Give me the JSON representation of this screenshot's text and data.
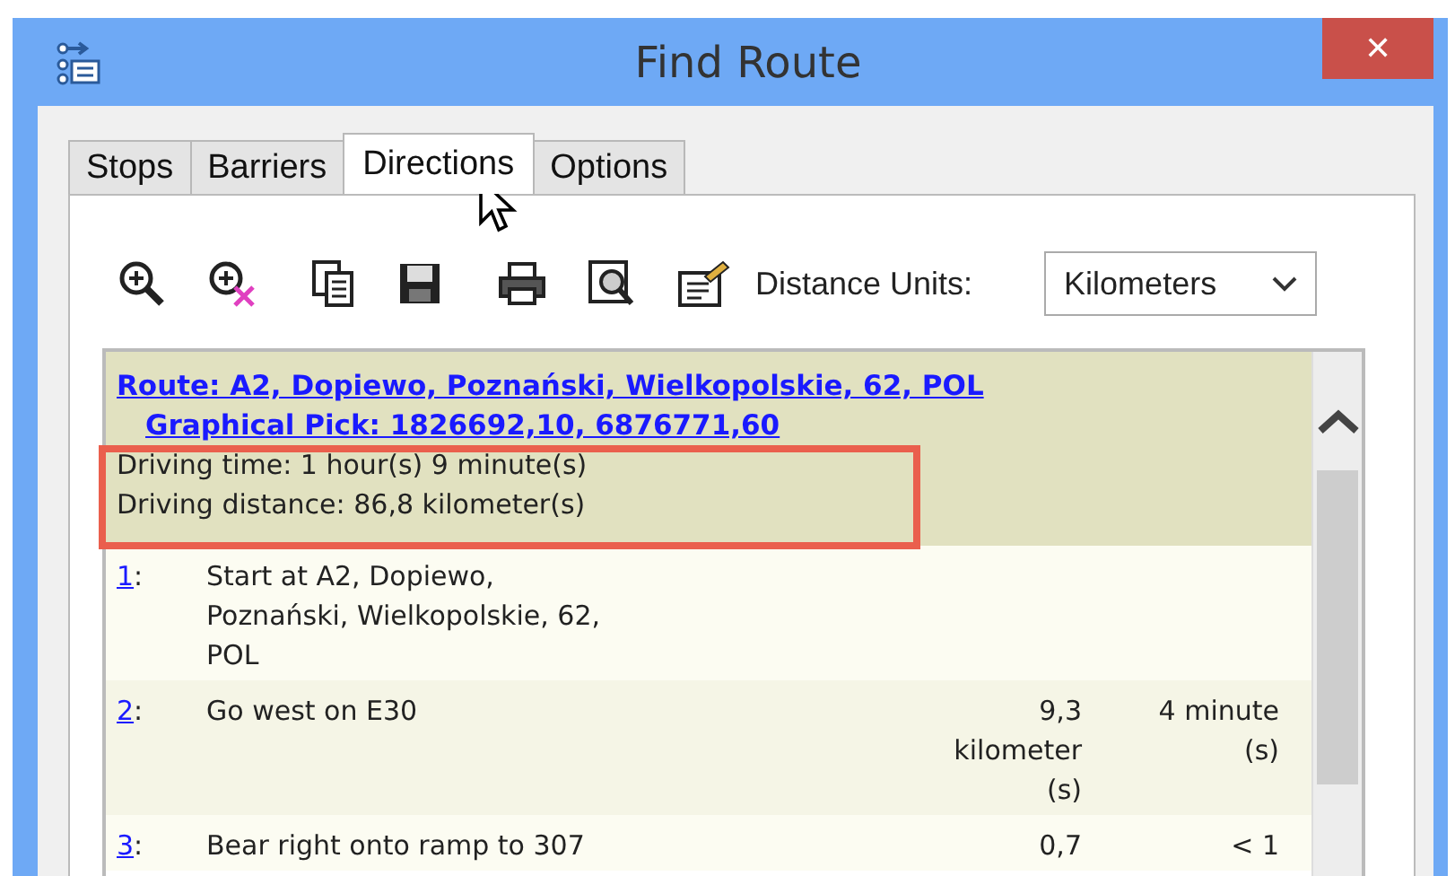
{
  "window": {
    "title": "Find Route",
    "close": "✕"
  },
  "tabs": [
    {
      "label": "Stops",
      "selected": false
    },
    {
      "label": "Barriers",
      "selected": false
    },
    {
      "label": "Directions",
      "selected": true
    },
    {
      "label": "Options",
      "selected": false
    }
  ],
  "toolbar": {
    "icons": [
      {
        "kind": "zoom-in"
      },
      {
        "kind": "zoom-out"
      },
      {
        "kind": "copy"
      },
      {
        "kind": "save"
      },
      {
        "kind": "print"
      },
      {
        "kind": "preview"
      },
      {
        "kind": "properties"
      }
    ],
    "units_label": "Distance Units:",
    "units_value": "Kilometers"
  },
  "route": {
    "link_lines": [
      "Route: A2, Dopiewo, Poznański, Wielkopolskie, 62, POL",
      "Graphical Pick: 1826692,10, 6876771,60"
    ],
    "summary": [
      "Driving time: 1 hour(s) 9 minute(s)",
      "Driving distance: 86,8 kilometer(s)"
    ]
  },
  "steps": [
    {
      "number": "1",
      "separator": ":",
      "text": "Start at A2, Dopiewo, Poznański, Wielkopolskie, 62, POL"
    },
    {
      "number": "2",
      "separator": ":",
      "text": "Go west on E30",
      "distance": "9,3 kilometer (s)",
      "time": "4 minute (s)"
    },
    {
      "number": "3",
      "separator": ":",
      "text": "Bear right onto ramp to 307",
      "distance": "0,7",
      "time": "< 1"
    }
  ]
}
